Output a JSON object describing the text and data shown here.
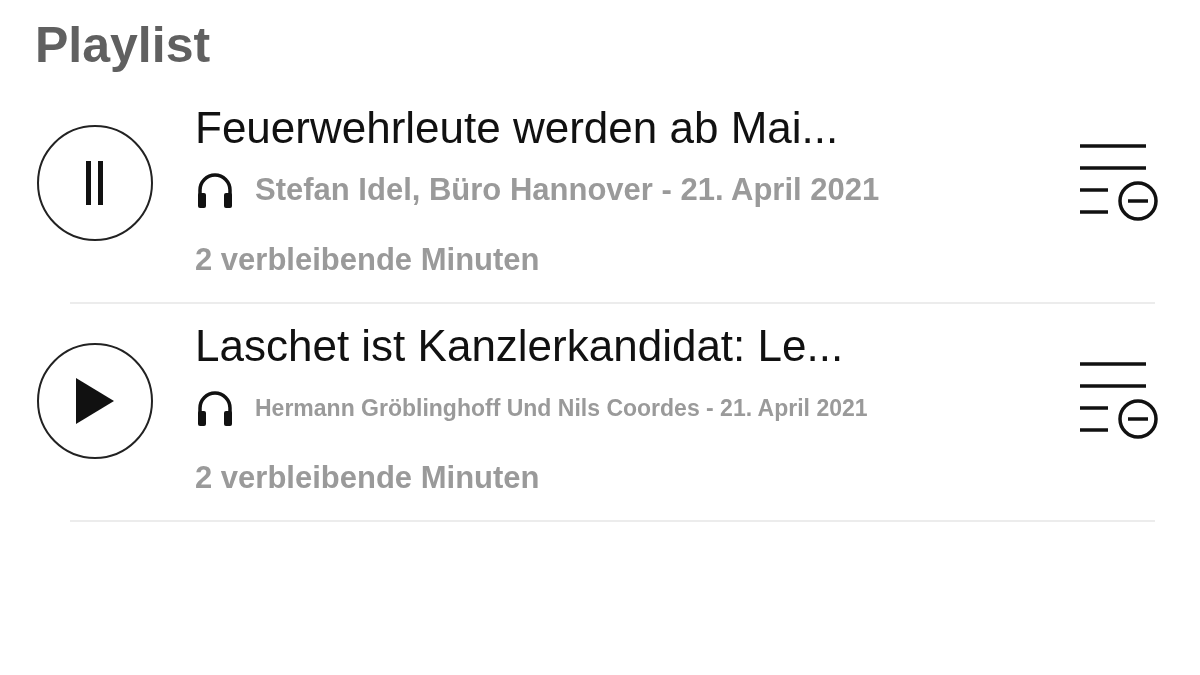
{
  "header": {
    "title": "Playlist"
  },
  "items": [
    {
      "title": "Feuerwehrleute werden ab Mai...",
      "byline": "Stefan Idel, Büro Hannover - 21. April 2021",
      "remaining": "2 verbleibende Minuten",
      "playing": true
    },
    {
      "title": "Laschet ist Kanzlerkandidat: Le...",
      "byline": "Hermann Gröblinghoff Und Nils Coordes - 21. April 2021",
      "remaining": "2 verbleibende Minuten",
      "playing": false
    }
  ]
}
